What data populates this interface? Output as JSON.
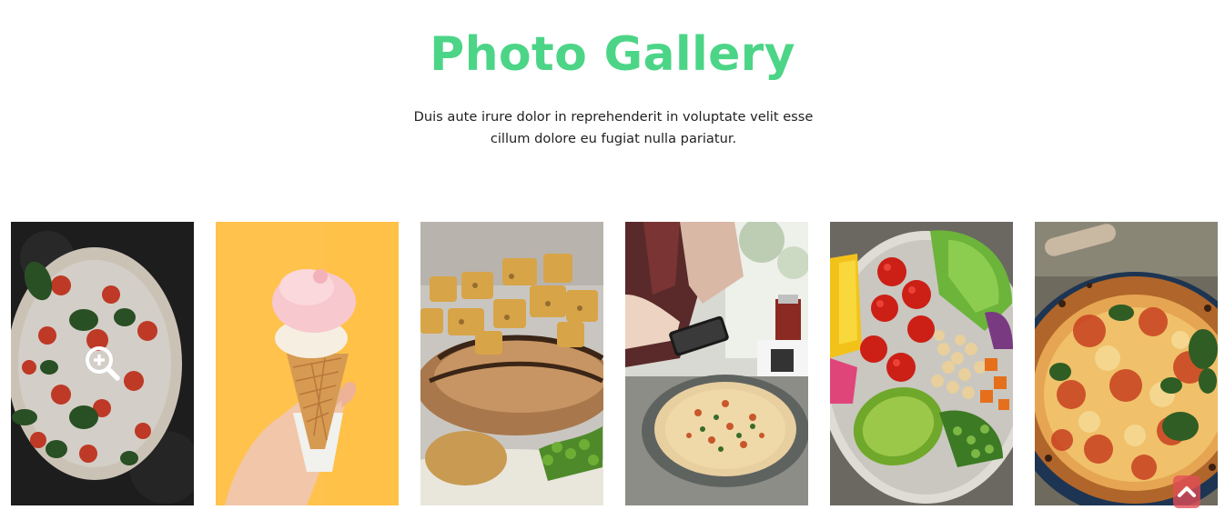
{
  "section": {
    "title": "Photo Gallery",
    "subtitle": "Duis aute irure dolor in reprehenderit in voluptate velit esse cillum dolore eu fugiat nulla pariatur.",
    "title_color": "#4cd587"
  },
  "gallery": {
    "items": [
      {
        "subject": "margherita pizza on dark stone",
        "hovered": true
      },
      {
        "subject": "ice cream cone on yellow background",
        "hovered": false
      },
      {
        "subject": "grilled meat with roasted potatoes",
        "hovered": false
      },
      {
        "subject": "woman with phone and pizza on cafe table",
        "hovered": false
      },
      {
        "subject": "salad bowl with tomatoes, avocado and chickpeas",
        "hovered": false
      },
      {
        "subject": "pizza with basil close-up",
        "hovered": false
      }
    ]
  },
  "icons": {
    "zoom": "zoom-in-icon",
    "back_to_top": "chevron-up-icon"
  },
  "colors": {
    "accent": "#4cd587",
    "back_to_top_bg": "#e24c56"
  }
}
